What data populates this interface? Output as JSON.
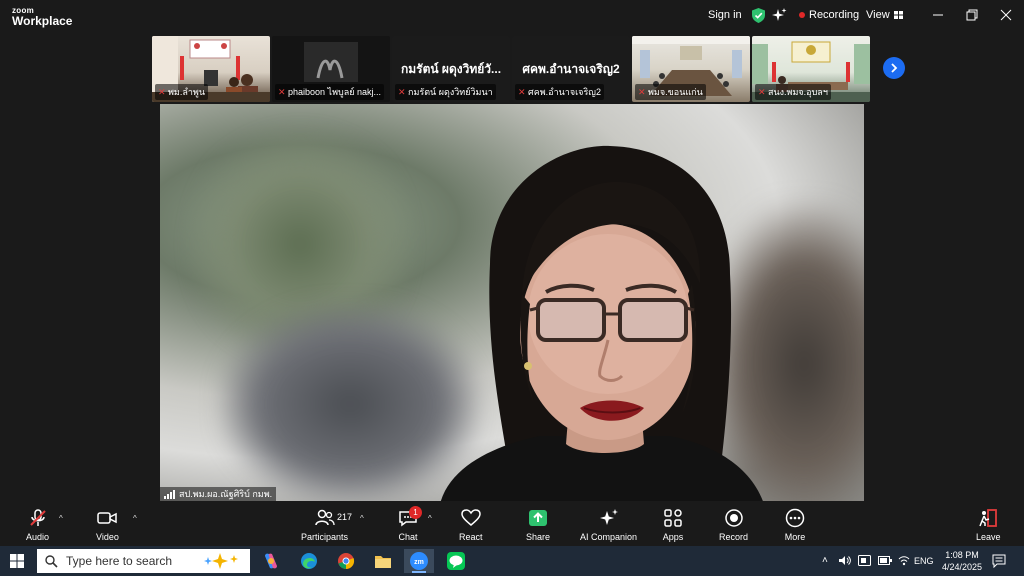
{
  "app": {
    "logo_line1": "zoom",
    "logo_line2": "Workplace",
    "signin": "Sign in",
    "recording": "Recording",
    "view": "View"
  },
  "thumbnails": [
    {
      "name": "พม.ลำพูน",
      "video": true
    },
    {
      "name": "phaiboon ไพบูลย์ nakj...",
      "video": true
    },
    {
      "name": "กมรัตน์ ผดุงวิทย์วิมนา",
      "bigname": "กมรัตน์ ผดุงวิทย์วั...",
      "video": false
    },
    {
      "name": "ศคพ.อำนาจเจริญ2",
      "bigname": "ศคพ.อำนาจเจริญ2",
      "video": false
    },
    {
      "name": "พมจ.ขอนแก่น",
      "video": true
    },
    {
      "name": "สนง.พมจ.อุบลฯ",
      "video": true
    }
  ],
  "speaker": {
    "name": "สป.พม.ผอ.ณัฐศิริบ์ กมพ."
  },
  "toolbar": {
    "audio": "Audio",
    "video": "Video",
    "participants": "Participants",
    "participants_count": "217",
    "chat": "Chat",
    "chat_badge": "1",
    "react": "React",
    "share": "Share",
    "ai_companion": "AI Companion",
    "apps": "Apps",
    "record": "Record",
    "more": "More",
    "leave": "Leave"
  },
  "taskbar": {
    "search_placeholder": "Type here to search",
    "lang": "ENG",
    "time": "1:08 PM",
    "date": "4/24/2025"
  },
  "colors": {
    "share_green": "#2ec26f",
    "leave_red": "#e03b3b",
    "accent_blue": "#1c6cf2",
    "recording_red": "#e02828"
  }
}
